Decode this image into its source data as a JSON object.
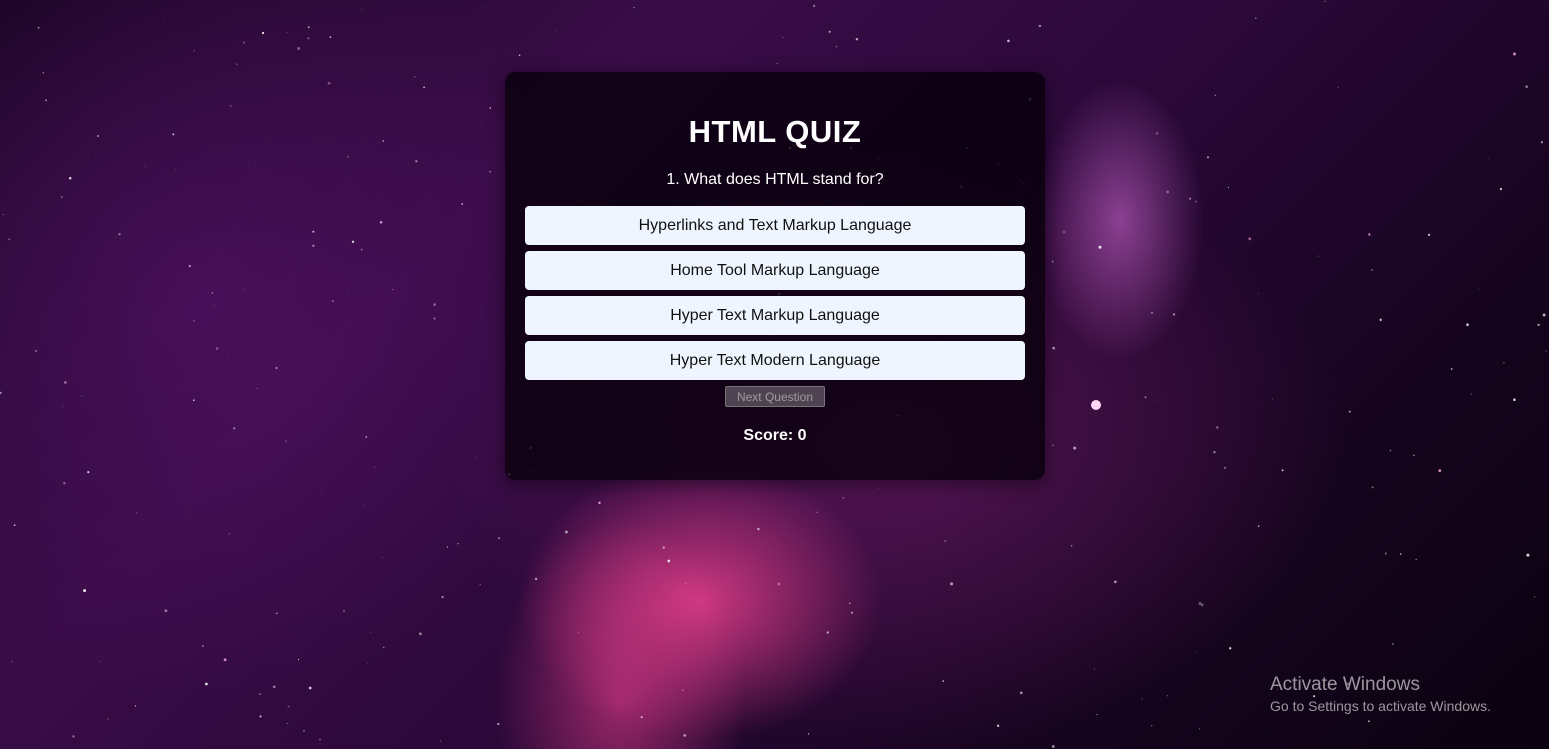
{
  "quiz": {
    "title": "HTML QUIZ",
    "question": "1. What does HTML stand for?",
    "answers": [
      "Hyperlinks and Text Markup Language",
      "Home Tool Markup Language",
      "Hyper Text Markup Language",
      "Hyper Text Modern Language"
    ],
    "next_label": "Next Question",
    "next_disabled": true,
    "score_label": "Score: 0"
  },
  "watermark": {
    "title": "Activate Windows",
    "subtitle": "Go to Settings to activate Windows."
  },
  "colors": {
    "card_bg": "#08000c",
    "answer_bg": "#eef5ff",
    "text": "#ffffff"
  }
}
